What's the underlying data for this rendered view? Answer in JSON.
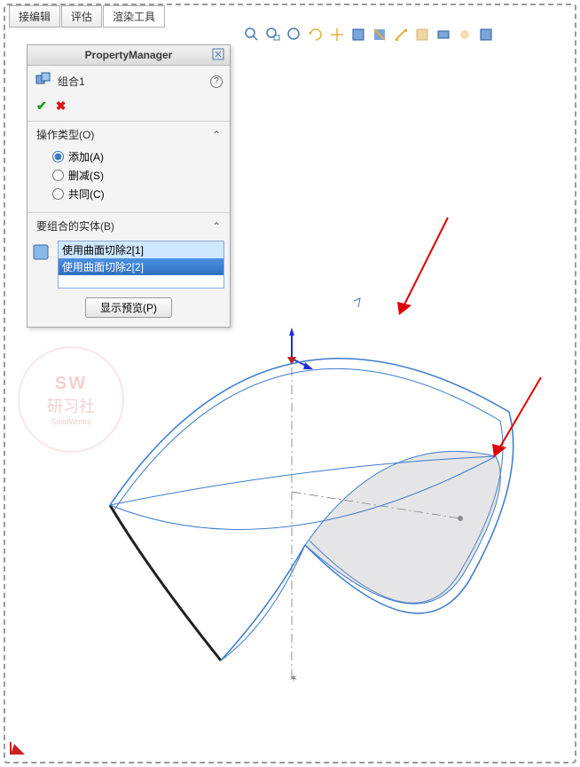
{
  "tabs": {
    "t1": "接编辑",
    "t2": "评估",
    "t3": "渲染工具"
  },
  "panel": {
    "title": "PropertyManager",
    "feature_name": "组合1",
    "section1": {
      "header": "操作类型(O)",
      "opt_add": "添加(A)",
      "opt_sub": "删减(S)",
      "opt_common": "共同(C)"
    },
    "section2": {
      "header": "要组合的实体(B)",
      "item1": "使用曲面切除2[1]",
      "item2": "使用曲面切除2[2]"
    },
    "preview_btn": "显示预览(P)"
  },
  "watermark": {
    "line1": "SW",
    "line2": "研习社",
    "line3": "SolidWorks"
  }
}
